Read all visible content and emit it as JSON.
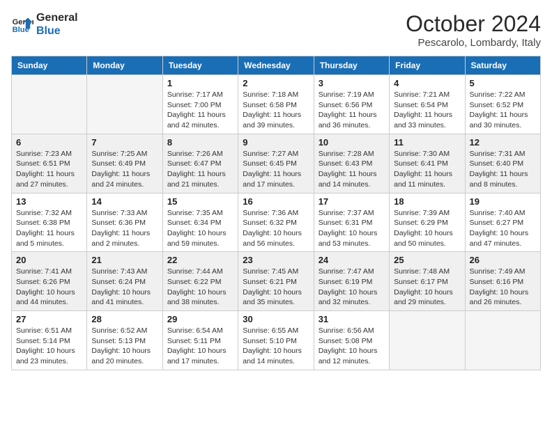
{
  "logo": {
    "line1": "General",
    "line2": "Blue"
  },
  "title": "October 2024",
  "location": "Pescarolo, Lombardy, Italy",
  "days_header": [
    "Sunday",
    "Monday",
    "Tuesday",
    "Wednesday",
    "Thursday",
    "Friday",
    "Saturday"
  ],
  "weeks": [
    [
      {
        "day": "",
        "info": ""
      },
      {
        "day": "",
        "info": ""
      },
      {
        "day": "1",
        "info": "Sunrise: 7:17 AM\nSunset: 7:00 PM\nDaylight: 11 hours and 42 minutes."
      },
      {
        "day": "2",
        "info": "Sunrise: 7:18 AM\nSunset: 6:58 PM\nDaylight: 11 hours and 39 minutes."
      },
      {
        "day": "3",
        "info": "Sunrise: 7:19 AM\nSunset: 6:56 PM\nDaylight: 11 hours and 36 minutes."
      },
      {
        "day": "4",
        "info": "Sunrise: 7:21 AM\nSunset: 6:54 PM\nDaylight: 11 hours and 33 minutes."
      },
      {
        "day": "5",
        "info": "Sunrise: 7:22 AM\nSunset: 6:52 PM\nDaylight: 11 hours and 30 minutes."
      }
    ],
    [
      {
        "day": "6",
        "info": "Sunrise: 7:23 AM\nSunset: 6:51 PM\nDaylight: 11 hours and 27 minutes."
      },
      {
        "day": "7",
        "info": "Sunrise: 7:25 AM\nSunset: 6:49 PM\nDaylight: 11 hours and 24 minutes."
      },
      {
        "day": "8",
        "info": "Sunrise: 7:26 AM\nSunset: 6:47 PM\nDaylight: 11 hours and 21 minutes."
      },
      {
        "day": "9",
        "info": "Sunrise: 7:27 AM\nSunset: 6:45 PM\nDaylight: 11 hours and 17 minutes."
      },
      {
        "day": "10",
        "info": "Sunrise: 7:28 AM\nSunset: 6:43 PM\nDaylight: 11 hours and 14 minutes."
      },
      {
        "day": "11",
        "info": "Sunrise: 7:30 AM\nSunset: 6:41 PM\nDaylight: 11 hours and 11 minutes."
      },
      {
        "day": "12",
        "info": "Sunrise: 7:31 AM\nSunset: 6:40 PM\nDaylight: 11 hours and 8 minutes."
      }
    ],
    [
      {
        "day": "13",
        "info": "Sunrise: 7:32 AM\nSunset: 6:38 PM\nDaylight: 11 hours and 5 minutes."
      },
      {
        "day": "14",
        "info": "Sunrise: 7:33 AM\nSunset: 6:36 PM\nDaylight: 11 hours and 2 minutes."
      },
      {
        "day": "15",
        "info": "Sunrise: 7:35 AM\nSunset: 6:34 PM\nDaylight: 10 hours and 59 minutes."
      },
      {
        "day": "16",
        "info": "Sunrise: 7:36 AM\nSunset: 6:32 PM\nDaylight: 10 hours and 56 minutes."
      },
      {
        "day": "17",
        "info": "Sunrise: 7:37 AM\nSunset: 6:31 PM\nDaylight: 10 hours and 53 minutes."
      },
      {
        "day": "18",
        "info": "Sunrise: 7:39 AM\nSunset: 6:29 PM\nDaylight: 10 hours and 50 minutes."
      },
      {
        "day": "19",
        "info": "Sunrise: 7:40 AM\nSunset: 6:27 PM\nDaylight: 10 hours and 47 minutes."
      }
    ],
    [
      {
        "day": "20",
        "info": "Sunrise: 7:41 AM\nSunset: 6:26 PM\nDaylight: 10 hours and 44 minutes."
      },
      {
        "day": "21",
        "info": "Sunrise: 7:43 AM\nSunset: 6:24 PM\nDaylight: 10 hours and 41 minutes."
      },
      {
        "day": "22",
        "info": "Sunrise: 7:44 AM\nSunset: 6:22 PM\nDaylight: 10 hours and 38 minutes."
      },
      {
        "day": "23",
        "info": "Sunrise: 7:45 AM\nSunset: 6:21 PM\nDaylight: 10 hours and 35 minutes."
      },
      {
        "day": "24",
        "info": "Sunrise: 7:47 AM\nSunset: 6:19 PM\nDaylight: 10 hours and 32 minutes."
      },
      {
        "day": "25",
        "info": "Sunrise: 7:48 AM\nSunset: 6:17 PM\nDaylight: 10 hours and 29 minutes."
      },
      {
        "day": "26",
        "info": "Sunrise: 7:49 AM\nSunset: 6:16 PM\nDaylight: 10 hours and 26 minutes."
      }
    ],
    [
      {
        "day": "27",
        "info": "Sunrise: 6:51 AM\nSunset: 5:14 PM\nDaylight: 10 hours and 23 minutes."
      },
      {
        "day": "28",
        "info": "Sunrise: 6:52 AM\nSunset: 5:13 PM\nDaylight: 10 hours and 20 minutes."
      },
      {
        "day": "29",
        "info": "Sunrise: 6:54 AM\nSunset: 5:11 PM\nDaylight: 10 hours and 17 minutes."
      },
      {
        "day": "30",
        "info": "Sunrise: 6:55 AM\nSunset: 5:10 PM\nDaylight: 10 hours and 14 minutes."
      },
      {
        "day": "31",
        "info": "Sunrise: 6:56 AM\nSunset: 5:08 PM\nDaylight: 10 hours and 12 minutes."
      },
      {
        "day": "",
        "info": ""
      },
      {
        "day": "",
        "info": ""
      }
    ]
  ]
}
